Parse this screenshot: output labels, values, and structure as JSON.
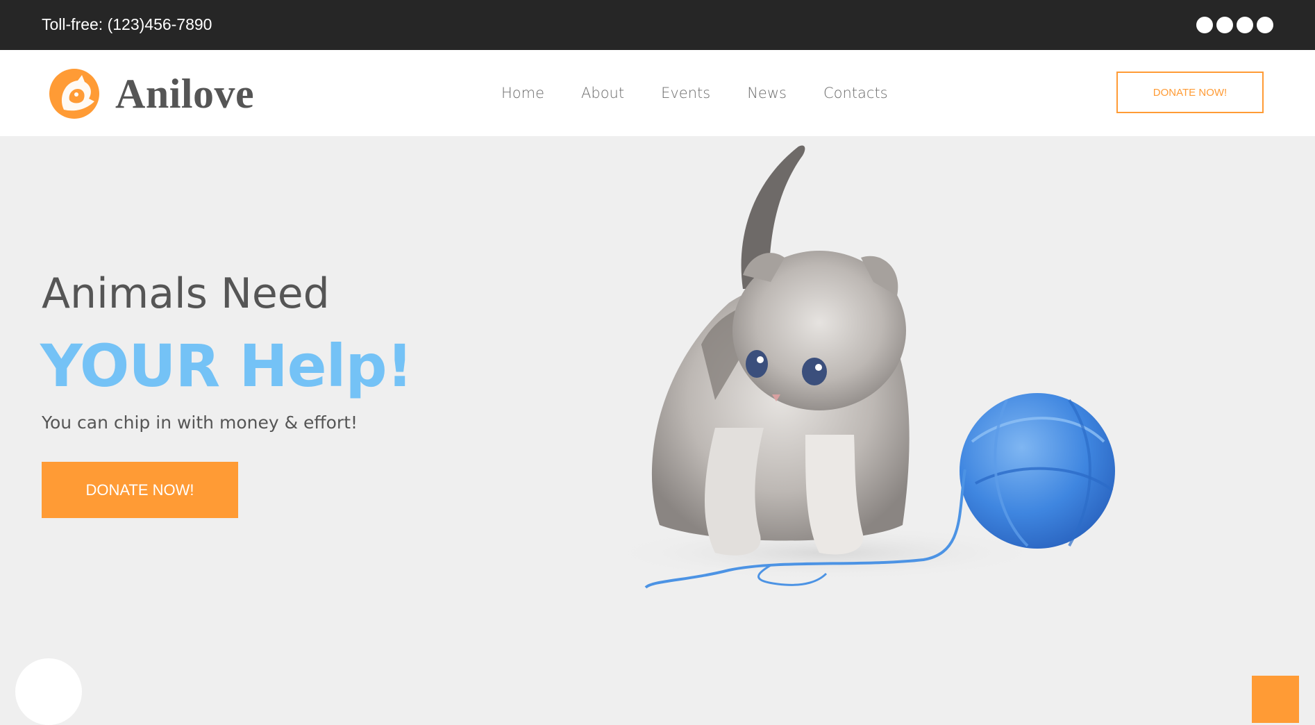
{
  "topbar": {
    "phone_text": "Toll-free: (123)456-7890",
    "social_icons": [
      "social-icon-1",
      "social-icon-2",
      "social-icon-3",
      "social-icon-4"
    ]
  },
  "header": {
    "logo_text": "Anilove",
    "nav": [
      "Home",
      "About",
      "Events",
      "News",
      "Contacts"
    ],
    "donate_label": "DONATE NOW!"
  },
  "hero": {
    "line1": "Animals Need",
    "line2": "YOUR Help!",
    "subtitle": "You can chip in with money & effort!",
    "donate_label": "DONATE NOW!"
  },
  "colors": {
    "accent_orange": "#ff9b35",
    "hero_blue": "#74c2f6",
    "topbar_dark": "#262626",
    "hero_bg": "#efefef",
    "text_gray": "#555555"
  }
}
